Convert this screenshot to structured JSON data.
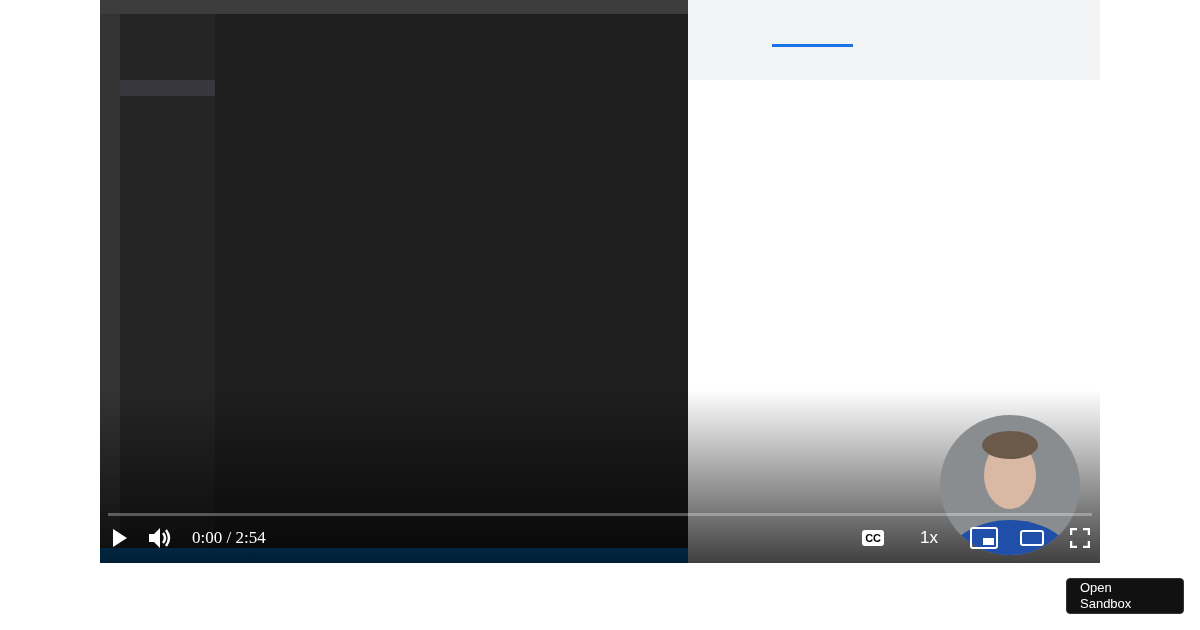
{
  "player": {
    "progress": {
      "level": 0
    },
    "time": "0:00 / 2:54",
    "captions": "CC",
    "speed": "1x"
  },
  "sandbox_button": "Open Sandbox"
}
